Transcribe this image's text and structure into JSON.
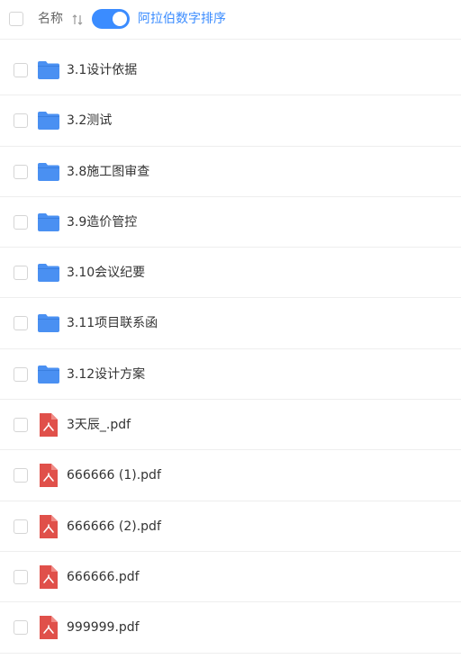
{
  "header": {
    "column_name": "名称",
    "sort_mode_label": "阿拉伯数字排序",
    "sort_toggle_on": true
  },
  "colors": {
    "accent": "#3b8cff",
    "folder": "#4a90f2",
    "pdf": "#e0504a"
  },
  "files": [
    {
      "name": "3.1设计依据",
      "type": "folder"
    },
    {
      "name": "3.2测试",
      "type": "folder"
    },
    {
      "name": "3.8施工图审查",
      "type": "folder"
    },
    {
      "name": "3.9造价管控",
      "type": "folder"
    },
    {
      "name": "3.10会议纪要",
      "type": "folder"
    },
    {
      "name": "3.11项目联系函",
      "type": "folder"
    },
    {
      "name": "3.12设计方案",
      "type": "folder"
    },
    {
      "name": "3天辰_.pdf",
      "type": "pdf"
    },
    {
      "name": "666666 (1).pdf",
      "type": "pdf"
    },
    {
      "name": "666666 (2).pdf",
      "type": "pdf"
    },
    {
      "name": "666666.pdf",
      "type": "pdf"
    },
    {
      "name": "999999.pdf",
      "type": "pdf"
    }
  ]
}
